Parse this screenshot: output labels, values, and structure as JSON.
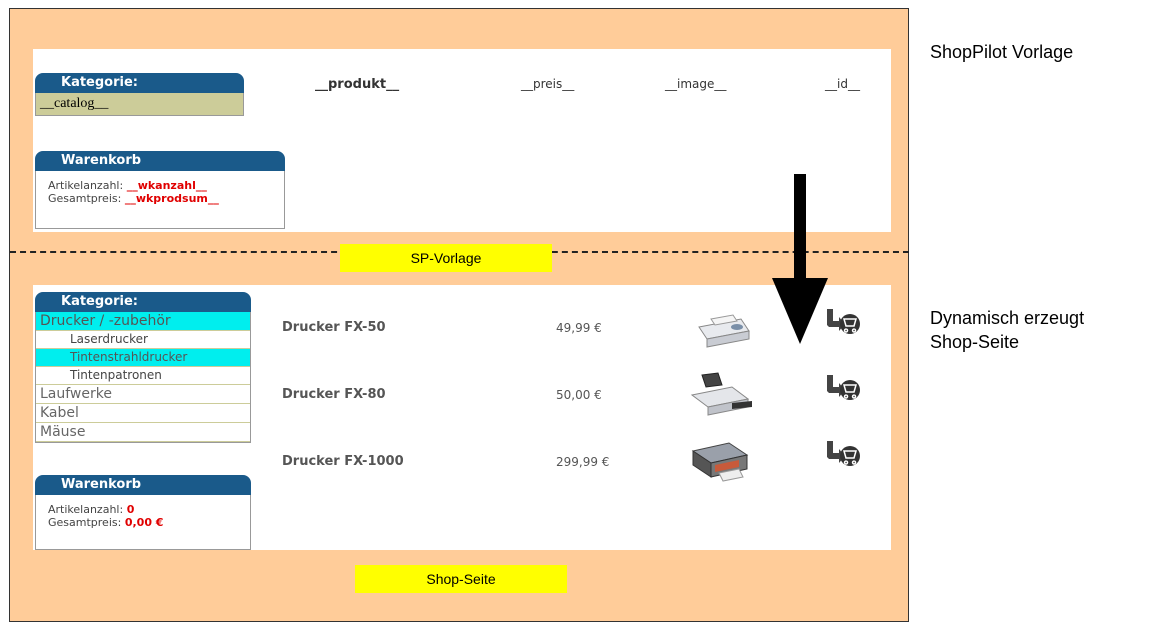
{
  "labels": {
    "sp_vorlage": "SP-Vorlage",
    "shop_seite": "Shop-Seite",
    "right_top": "ShopPilot Vorlage",
    "right_bottom_line1": "Dynamisch erzeugt",
    "right_bottom_line2": "Shop-Seite"
  },
  "template": {
    "kategorie_title": "Kategorie:",
    "catalog_placeholder": "__catalog__",
    "columns": {
      "produkt": "__produkt__",
      "preis": "__preis__",
      "image": "__image__",
      "id": "__id__"
    },
    "warenkorb_title": "Warenkorb",
    "artikelanzahl_label": "Artikelanzahl:",
    "artikelanzahl_value": "__wkanzahl__",
    "gesamtpreis_label": "Gesamtpreis:",
    "gesamtpreis_value": "__wkprodsum__"
  },
  "shop": {
    "kategorie_title": "Kategorie:",
    "categories": [
      {
        "label": "Drucker / -zubehör",
        "level": 0,
        "highlight": true
      },
      {
        "label": "Laserdrucker",
        "level": 1,
        "highlight": false
      },
      {
        "label": "Tintenstrahldrucker",
        "level": 1,
        "highlight": true
      },
      {
        "label": "Tintenpatronen",
        "level": 1,
        "highlight": false
      },
      {
        "label": "Laufwerke",
        "level": 0,
        "highlight": false
      },
      {
        "label": "Kabel",
        "level": 0,
        "highlight": false
      },
      {
        "label": "Mäuse",
        "level": 0,
        "highlight": false
      }
    ],
    "products": [
      {
        "name": "Drucker FX-50",
        "price": "49,99 €"
      },
      {
        "name": "Drucker FX-80",
        "price": "50,00 €"
      },
      {
        "name": "Drucker FX-1000",
        "price": "299,99 €"
      }
    ],
    "warenkorb_title": "Warenkorb",
    "artikelanzahl_label": "Artikelanzahl:",
    "artikelanzahl_value": "0",
    "gesamtpreis_label": "Gesamtpreis:",
    "gesamtpreis_value": "0,00 €"
  },
  "colors": {
    "background": "#ffcc99",
    "label_box": "#ffff00",
    "widget_header": "#1a5a8a",
    "highlight": "#00eeee",
    "placeholder_value": "#e00000"
  }
}
